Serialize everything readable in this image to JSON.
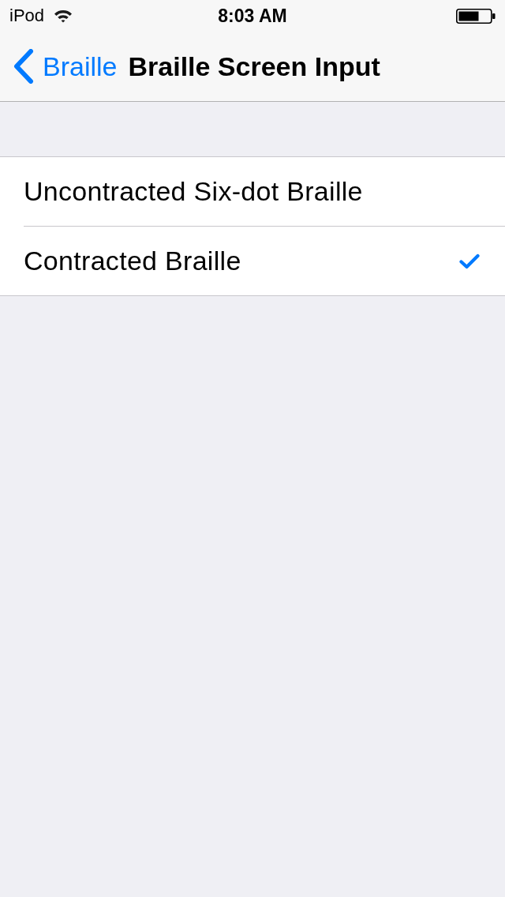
{
  "status_bar": {
    "carrier": "iPod",
    "time": "8:03 AM"
  },
  "nav_bar": {
    "back_label": "Braille",
    "title": "Braille Screen Input"
  },
  "options": [
    {
      "label": "Uncontracted Six-dot Braille",
      "selected": false
    },
    {
      "label": "Contracted Braille",
      "selected": true
    }
  ]
}
